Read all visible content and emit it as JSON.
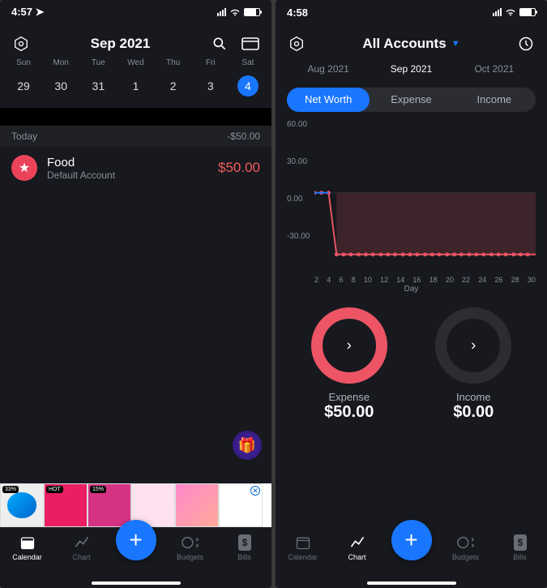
{
  "left": {
    "time": "4:57",
    "title": "Sep 2021",
    "weekdays": [
      "Sun",
      "Mon",
      "Tue",
      "Wed",
      "Thu",
      "Fri",
      "Sat"
    ],
    "dates": [
      "29",
      "30",
      "31",
      "1",
      "2",
      "3",
      "4"
    ],
    "selected_index": 6,
    "section": {
      "label": "Today",
      "total": "-$50.00"
    },
    "transaction": {
      "name": "Food",
      "sub": "Default Account",
      "amount": "$50.00"
    },
    "ad_badges": [
      "33%",
      "HOT",
      "15%"
    ],
    "tabs": [
      "Calendar",
      "Chart",
      "Budgets",
      "Bills"
    ]
  },
  "right": {
    "time": "4:58",
    "title": "All Accounts",
    "months": [
      "Aug 2021",
      "Sep 2021",
      "Oct 2021"
    ],
    "segments": [
      "Net Worth",
      "Expense",
      "Income"
    ],
    "active_segment": 0,
    "y_ticks": [
      "60.00",
      "30.00",
      "0.00",
      "-30.00"
    ],
    "x_ticks": [
      "2",
      "4",
      "6",
      "8",
      "10",
      "12",
      "14",
      "16",
      "18",
      "20",
      "22",
      "24",
      "26",
      "28",
      "30"
    ],
    "x_axis_label": "Day",
    "expense_ring": {
      "label": "Expense",
      "value": "$50.00"
    },
    "income_ring": {
      "label": "Income",
      "value": "$0.00"
    },
    "tabs": [
      "Calendar",
      "Chart",
      "Budgets",
      "Bills"
    ]
  },
  "chart_data": {
    "type": "line",
    "title": "Net Worth",
    "xlabel": "Day",
    "ylabel": "",
    "ylim": [
      -60,
      60
    ],
    "x": [
      1,
      2,
      3,
      4,
      5,
      6,
      7,
      8,
      9,
      10,
      11,
      12,
      13,
      14,
      15,
      16,
      17,
      18,
      19,
      20,
      21,
      22,
      23,
      24,
      25,
      26,
      27,
      28,
      29,
      30
    ],
    "series": [
      {
        "name": "Net Worth",
        "values": [
          0,
          0,
          0,
          -50,
          -50,
          -50,
          -50,
          -50,
          -50,
          -50,
          -50,
          -50,
          -50,
          -50,
          -50,
          -50,
          -50,
          -50,
          -50,
          -50,
          -50,
          -50,
          -50,
          -50,
          -50,
          -50,
          -50,
          -50,
          -50,
          -50
        ]
      }
    ]
  }
}
